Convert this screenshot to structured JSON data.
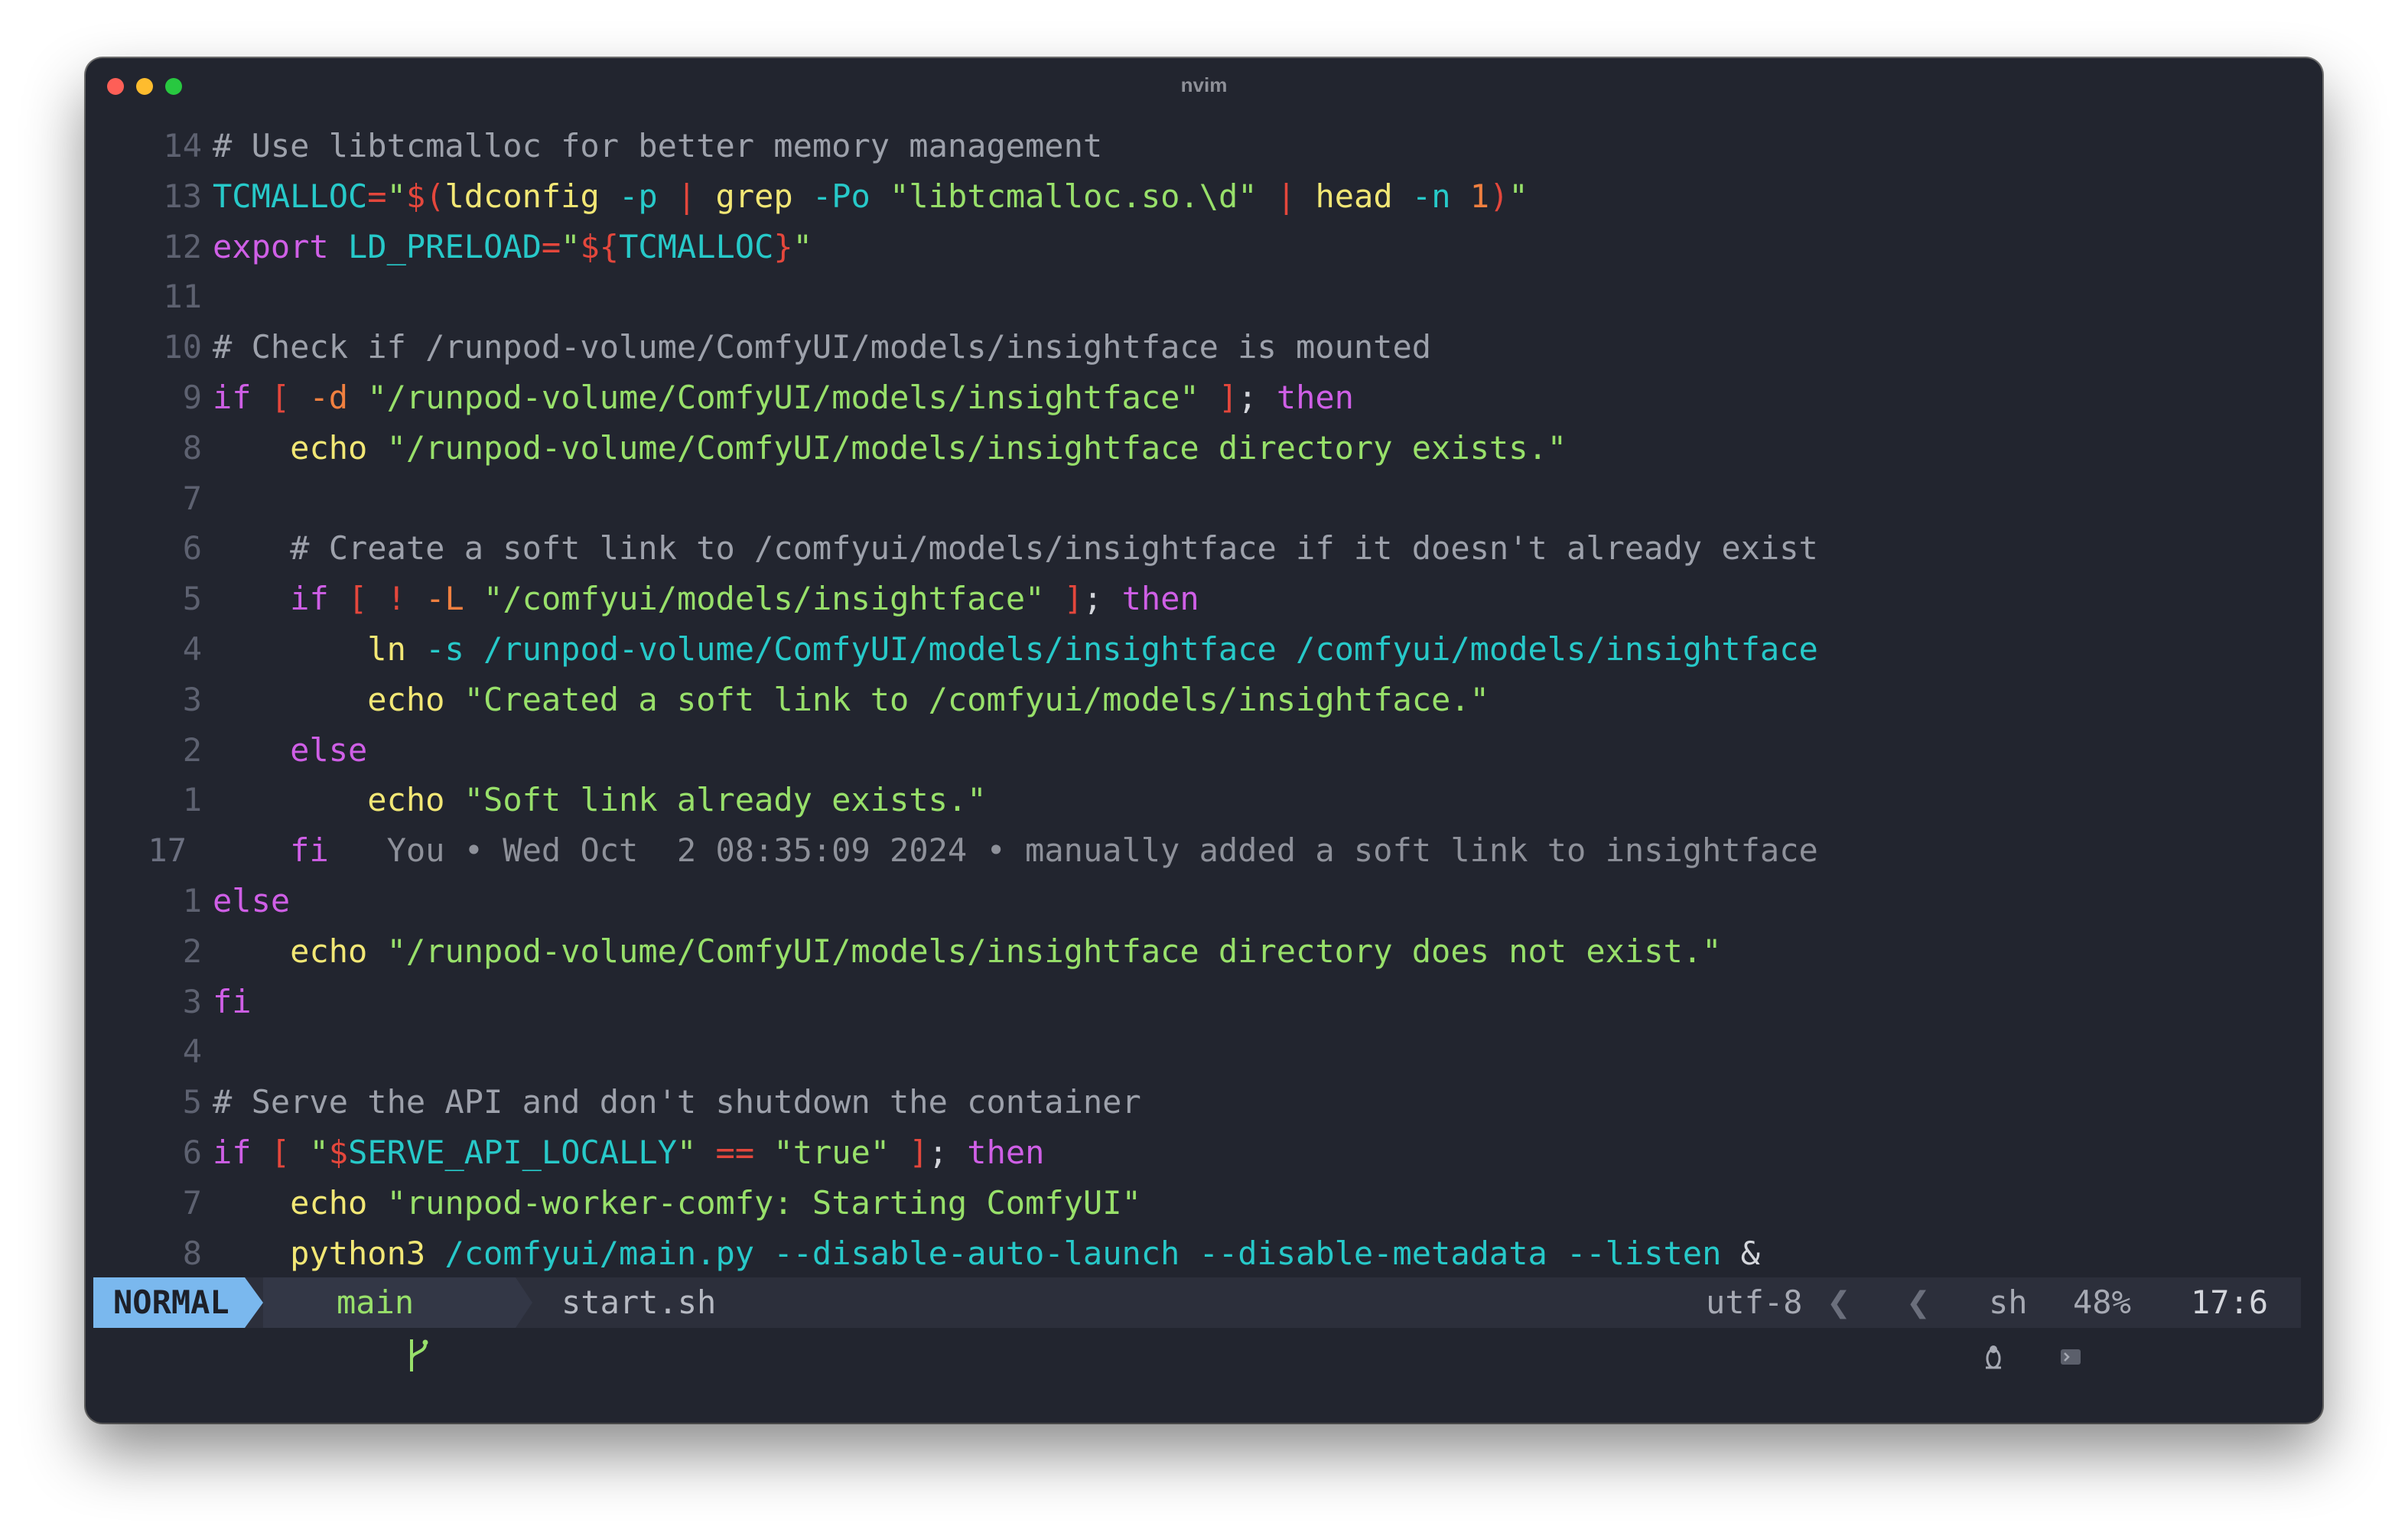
{
  "window": {
    "title": "nvim"
  },
  "lines": [
    {
      "num": "14",
      "parts": [
        [
          "c",
          "# Use libtcmalloc for better memory management"
        ]
      ]
    },
    {
      "num": "13",
      "parts": [
        [
          "v",
          "TCMALLOC"
        ],
        [
          "r",
          "="
        ],
        [
          "s",
          "\""
        ],
        [
          "r",
          "$("
        ],
        [
          "f",
          "ldconfig"
        ],
        [
          "p",
          " "
        ],
        [
          "v",
          "-p"
        ],
        [
          "p",
          " "
        ],
        [
          "r",
          "|"
        ],
        [
          "p",
          " "
        ],
        [
          "f",
          "grep"
        ],
        [
          "p",
          " "
        ],
        [
          "v",
          "-Po"
        ],
        [
          "p",
          " "
        ],
        [
          "s",
          "\"libtcmalloc.so.\\d\""
        ],
        [
          "p",
          " "
        ],
        [
          "r",
          "|"
        ],
        [
          "p",
          " "
        ],
        [
          "f",
          "head"
        ],
        [
          "p",
          " "
        ],
        [
          "v",
          "-n"
        ],
        [
          "p",
          " "
        ],
        [
          "o",
          "1"
        ],
        [
          "r",
          ")"
        ],
        [
          "s",
          "\""
        ]
      ]
    },
    {
      "num": "12",
      "parts": [
        [
          "k",
          "export"
        ],
        [
          "p",
          " "
        ],
        [
          "v",
          "LD_PRELOAD"
        ],
        [
          "r",
          "="
        ],
        [
          "s",
          "\""
        ],
        [
          "r",
          "${"
        ],
        [
          "v",
          "TCMALLOC"
        ],
        [
          "r",
          "}"
        ],
        [
          "s",
          "\""
        ]
      ]
    },
    {
      "num": "11",
      "parts": []
    },
    {
      "num": "10",
      "parts": [
        [
          "c",
          "# Check if /runpod-volume/ComfyUI/models/insightface is mounted"
        ]
      ]
    },
    {
      "num": "9",
      "parts": [
        [
          "k",
          "if"
        ],
        [
          "p",
          " "
        ],
        [
          "r",
          "["
        ],
        [
          "p",
          " "
        ],
        [
          "o",
          "-d"
        ],
        [
          "p",
          " "
        ],
        [
          "s",
          "\"/runpod-volume/ComfyUI/models/insightface\""
        ],
        [
          "p",
          " "
        ],
        [
          "r",
          "]"
        ],
        [
          "p",
          "; "
        ],
        [
          "k",
          "then"
        ]
      ]
    },
    {
      "num": "8",
      "parts": [
        [
          "p",
          "    "
        ],
        [
          "f",
          "echo"
        ],
        [
          "p",
          " "
        ],
        [
          "s",
          "\"/runpod-volume/ComfyUI/models/insightface directory exists.\""
        ]
      ]
    },
    {
      "num": "7",
      "parts": []
    },
    {
      "num": "6",
      "parts": [
        [
          "p",
          "    "
        ],
        [
          "c",
          "# Create a soft link to /comfyui/models/insightface if it doesn't already exist"
        ]
      ]
    },
    {
      "num": "5",
      "parts": [
        [
          "p",
          "    "
        ],
        [
          "k",
          "if"
        ],
        [
          "p",
          " "
        ],
        [
          "r",
          "["
        ],
        [
          "p",
          " "
        ],
        [
          "r",
          "!"
        ],
        [
          "p",
          " "
        ],
        [
          "o",
          "-L"
        ],
        [
          "p",
          " "
        ],
        [
          "s",
          "\"/comfyui/models/insightface\""
        ],
        [
          "p",
          " "
        ],
        [
          "r",
          "]"
        ],
        [
          "p",
          "; "
        ],
        [
          "k",
          "then"
        ]
      ]
    },
    {
      "num": "4",
      "parts": [
        [
          "p",
          "        "
        ],
        [
          "f",
          "ln"
        ],
        [
          "p",
          " "
        ],
        [
          "v",
          "-s /runpod-volume/ComfyUI/models/insightface /comfyui/models/insightface"
        ]
      ]
    },
    {
      "num": "3",
      "parts": [
        [
          "p",
          "        "
        ],
        [
          "f",
          "echo"
        ],
        [
          "p",
          " "
        ],
        [
          "s",
          "\"Created a soft link to /comfyui/models/insightface.\""
        ]
      ]
    },
    {
      "num": "2",
      "parts": [
        [
          "p",
          "    "
        ],
        [
          "k",
          "else"
        ]
      ]
    },
    {
      "num": "1",
      "parts": [
        [
          "p",
          "        "
        ],
        [
          "f",
          "echo"
        ],
        [
          "p",
          " "
        ],
        [
          "s",
          "\"Soft link already exists.\""
        ]
      ]
    },
    {
      "num": "17",
      "current": true,
      "parts": [
        [
          "p",
          "    "
        ],
        [
          "k",
          "fi"
        ],
        [
          "blame",
          "   You • Wed Oct  2 08:35:09 2024 • manually added a soft link to insightface"
        ]
      ]
    },
    {
      "num": "1",
      "parts": [
        [
          "k",
          "else"
        ]
      ]
    },
    {
      "num": "2",
      "parts": [
        [
          "p",
          "    "
        ],
        [
          "f",
          "echo"
        ],
        [
          "p",
          " "
        ],
        [
          "s",
          "\"/runpod-volume/ComfyUI/models/insightface directory does not exist.\""
        ]
      ]
    },
    {
      "num": "3",
      "parts": [
        [
          "k",
          "fi"
        ]
      ]
    },
    {
      "num": "4",
      "parts": []
    },
    {
      "num": "5",
      "parts": [
        [
          "c",
          "# Serve the API and don't shutdown the container"
        ]
      ]
    },
    {
      "num": "6",
      "parts": [
        [
          "k",
          "if"
        ],
        [
          "p",
          " "
        ],
        [
          "r",
          "["
        ],
        [
          "p",
          " "
        ],
        [
          "s",
          "\""
        ],
        [
          "r",
          "$"
        ],
        [
          "v",
          "SERVE_API_LOCALLY"
        ],
        [
          "s",
          "\""
        ],
        [
          "p",
          " "
        ],
        [
          "r",
          "=="
        ],
        [
          "p",
          " "
        ],
        [
          "s",
          "\"true\""
        ],
        [
          "p",
          " "
        ],
        [
          "r",
          "]"
        ],
        [
          "p",
          "; "
        ],
        [
          "k",
          "then"
        ]
      ]
    },
    {
      "num": "7",
      "parts": [
        [
          "p",
          "    "
        ],
        [
          "f",
          "echo"
        ],
        [
          "p",
          " "
        ],
        [
          "s",
          "\"runpod-worker-comfy: Starting ComfyUI\""
        ]
      ]
    },
    {
      "num": "8",
      "parts": [
        [
          "p",
          "    "
        ],
        [
          "f",
          "python3"
        ],
        [
          "p",
          " "
        ],
        [
          "v",
          "/comfyui/main.py --disable-auto-launch --disable-metadata --listen"
        ],
        [
          "p",
          " &"
        ]
      ]
    }
  ],
  "statusline": {
    "mode": "NORMAL",
    "branch_icon": "git-branch-icon",
    "branch": "main",
    "file": "start.sh",
    "encoding": "utf-8",
    "os_icon": "linux-tux-icon",
    "filetype_icon": "terminal-icon",
    "filetype": "sh",
    "progress": "48%",
    "position": "17:6"
  }
}
